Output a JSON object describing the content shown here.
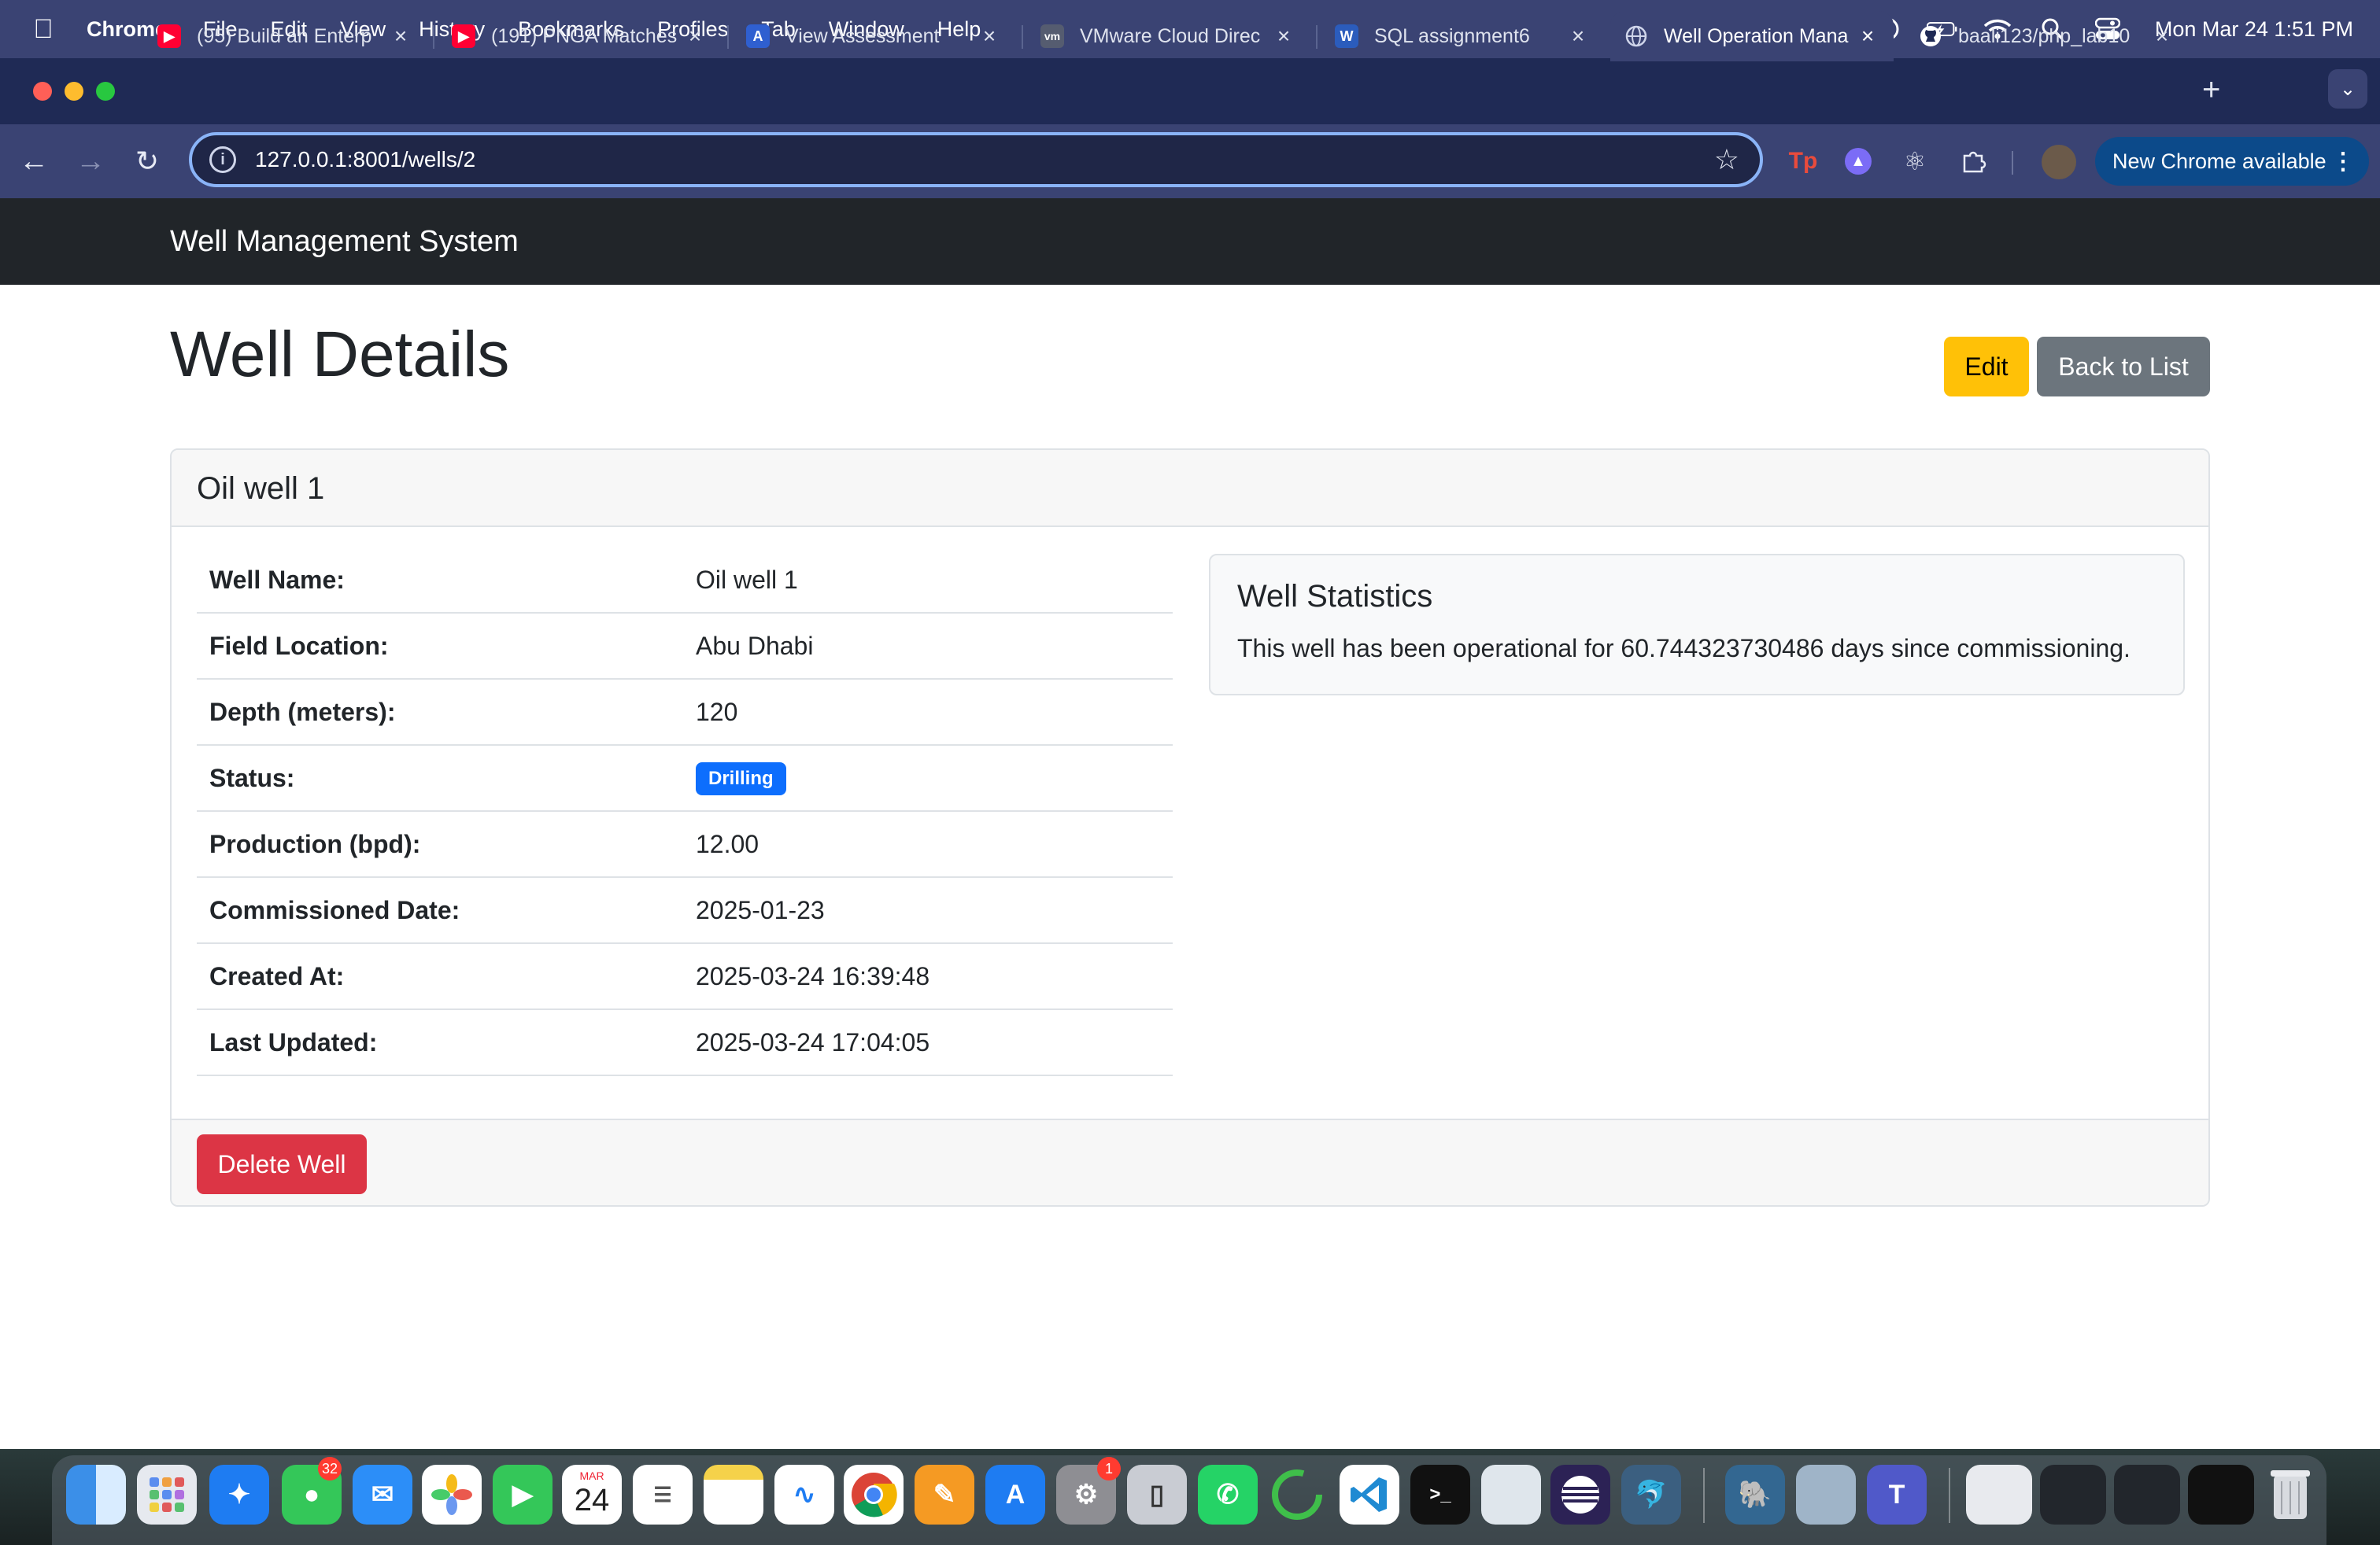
{
  "menubar": {
    "app_name": "Chrome",
    "items": [
      "File",
      "Edit",
      "View",
      "History",
      "Bookmarks",
      "Profiles",
      "Tab",
      "Window",
      "Help"
    ],
    "clock": "Mon Mar 24  1:51 PM",
    "status_icons": [
      "teams-icon",
      "elephant-icon",
      "play-icon",
      "battery-icon",
      "wifi-icon",
      "search-icon",
      "control-center-icon"
    ]
  },
  "browser": {
    "tabs": [
      {
        "title": "(95) Build an Enterp",
        "favicon": "youtube-icon",
        "active": false
      },
      {
        "title": "(191) PNGA Matches",
        "favicon": "youtube-icon",
        "active": false
      },
      {
        "title": "View Assessment",
        "favicon": "assessment-icon",
        "active": false
      },
      {
        "title": "VMware Cloud Direc",
        "favicon": "vmware-icon",
        "active": false
      },
      {
        "title": "SQL assignment6",
        "favicon": "word-icon",
        "active": false
      },
      {
        "title": "Well Operation Mana",
        "favicon": "globe-icon",
        "active": true
      },
      {
        "title": "baali123/php_lab10",
        "favicon": "github-icon",
        "active": false
      }
    ],
    "url": "127.0.0.1:8001/wells/2",
    "update_label": "New Chrome available",
    "accent_color": "#8ab4f8"
  },
  "app": {
    "brand": "Well Management System",
    "page_title": "Well Details",
    "edit_label": "Edit",
    "back_label": "Back to List",
    "card_title": "Oil well 1",
    "details": [
      {
        "label": "Well Name:",
        "value": "Oil well 1"
      },
      {
        "label": "Field Location:",
        "value": "Abu Dhabi"
      },
      {
        "label": "Depth (meters):",
        "value": "120"
      },
      {
        "label": "Status:",
        "value": "Drilling",
        "badge": true
      },
      {
        "label": "Production (bpd):",
        "value": "12.00"
      },
      {
        "label": "Commissioned Date:",
        "value": "2025-01-23"
      },
      {
        "label": "Created At:",
        "value": "2025-03-24 16:39:48"
      },
      {
        "label": "Last Updated:",
        "value": "2025-03-24 17:04:05"
      }
    ],
    "stats_title": "Well Statistics",
    "stats_text": "This well has been operational for 60.744323730486 days since commissioning.",
    "delete_label": "Delete Well",
    "colors": {
      "edit": "#ffc107",
      "back": "#6c757d",
      "delete": "#dc3545",
      "badge": "#0d6efd",
      "navbar": "#212529"
    }
  },
  "dock": {
    "calendar": {
      "month": "MAR",
      "day": "24"
    },
    "messages_badge": "32",
    "settings_badge": "1",
    "terminal_glyph": ">_",
    "apps": [
      "finder-icon",
      "launchpad-icon",
      "safari-icon",
      "messages-icon",
      "mail-icon",
      "photos-icon",
      "facetime-icon",
      "calendar-icon",
      "reminders-icon",
      "notes-icon",
      "freeform-icon",
      "chrome-icon",
      "pages-icon",
      "app-store-icon",
      "system-settings-icon",
      "iphone-mirroring-icon",
      "whatsapp-icon",
      "spinner-icon",
      "vscode-icon",
      "terminal-icon",
      "preview-icon",
      "eclipse-icon",
      "mysql-workbench-icon",
      "postgres-icon",
      "disk-utility-icon",
      "teams-icon",
      "trash-icon"
    ]
  }
}
